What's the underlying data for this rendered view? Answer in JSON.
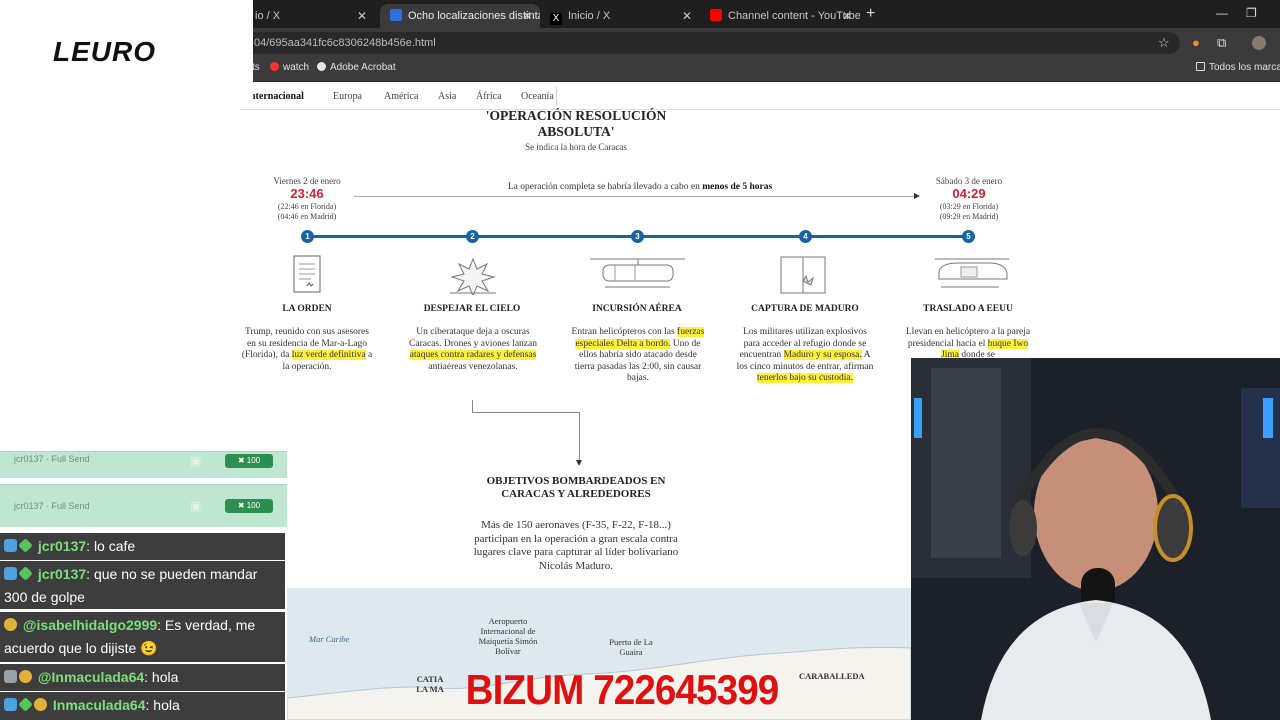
{
  "browser": {
    "tabs": [
      {
        "label": "io / X",
        "active": false
      },
      {
        "label": "Ocho localizaciones distintas p",
        "active": true
      },
      {
        "label": "Inicio / X",
        "active": false
      },
      {
        "label": "Channel content - YouTube Stu",
        "active": false
      }
    ],
    "url": "04/695aa341fc6c8306248b456e.html",
    "bookmarks": [
      {
        "label": "ts"
      },
      {
        "label": "watch"
      },
      {
        "label": "Adobe Acrobat"
      },
      {
        "label": "Todos los marcadores"
      }
    ]
  },
  "page": {
    "nav": [
      "nternacional",
      "Europa",
      "América",
      "Asia",
      "África",
      "Oceanía"
    ],
    "title": "'OPERACIÓN RESOLUCIÓN ABSOLUTA'",
    "subtitle": "Se indica la hora de Caracas",
    "start": {
      "day": "Viernes 2 de enero",
      "time": "23:46",
      "florida": "(22:46 en Florida)",
      "madrid": "(04:46 en Madrid)"
    },
    "end": {
      "day": "Sábado 3 de enero",
      "time": "04:29",
      "florida": "(03:29 en Florida)",
      "madrid": "(09:29 en Madrid)"
    },
    "duration": {
      "text": "La operación completa se habría llevado a cabo en ",
      "bold": "menos de 5 horas"
    },
    "stages": [
      {
        "num": "1",
        "title": "LA ORDEN",
        "parts": [
          [
            "Trump, reunido con sus asesores en su residencia de Mar-a-Lago (Florida), da ",
            false
          ],
          [
            "luz verde definitiva",
            true
          ],
          [
            " a la operación.",
            false
          ]
        ]
      },
      {
        "num": "2",
        "title": "DESPEJAR EL CIELO",
        "parts": [
          [
            "Un ciberataque deja a oscuras Caracas. Drones y aviones lanzan ",
            false
          ],
          [
            "ataques contra radares y defensas",
            true
          ],
          [
            " antiaéreas venezolanas.",
            false
          ]
        ]
      },
      {
        "num": "3",
        "title": "INCURSIÓN AÉREA",
        "parts": [
          [
            "Entran helicópteros con las ",
            false
          ],
          [
            "fuerzas especiales Delta a bordo.",
            true
          ],
          [
            " Uno de ellos habría sido atacado desde tierra pasadas las 2:00, sin causar bajas.",
            false
          ]
        ]
      },
      {
        "num": "4",
        "title": "CAPTURA DE MADURO",
        "parts": [
          [
            "Los militares utilizan explosivos para acceder al refugio donde se encuentran ",
            false
          ],
          [
            "Maduro y su esposa.",
            true
          ],
          [
            " A los cinco minutos de entrar, afirman ",
            false
          ],
          [
            "tenerlos bajo su custodia.",
            true
          ]
        ]
      },
      {
        "num": "5",
        "title": "TRASLADO A EEUU",
        "parts": [
          [
            "Llevan en helicóptero a la pareja presidencial hacia el ",
            false
          ],
          [
            "buque Iwo Jima",
            true
          ],
          [
            " donde se",
            false
          ]
        ]
      }
    ],
    "targets_title": "OBJETIVOS BOMBARDEADOS EN CARACAS Y ALREDEDORES",
    "targets_text": "Más de 150 aeronaves (F-35, F-22, F-18...) participan en la operación a gran escala contra lugares clave para capturar al líder bolivariano Nicolás Maduro.",
    "map_labels": {
      "sea": "Mar Caribe",
      "airport": "Aeropuerto Internacional de Maiquetía Simón Bolívar",
      "port": "Puerto de La Guaira",
      "left": "CATIA LA MA",
      "right": "CARABALLEDA"
    }
  },
  "overlay": {
    "logo": "LEURO",
    "alerts": [
      {
        "user": "jcr0137 · Full Send",
        "bits": "100"
      },
      {
        "user": "jcr0137 · Full Send",
        "bits": "100"
      }
    ],
    "chat": [
      {
        "name": "jcr0137",
        "msg": ": lo cafe"
      },
      {
        "name": "jcr0137",
        "msg": ": que no se pueden mandar 300 de golpe"
      },
      {
        "name": "@isabelhidalgo2999",
        "msg": ": Es verdad, me acuerdo que lo dijiste 😉"
      },
      {
        "name": "@Inmaculada64",
        "msg": ": hola"
      },
      {
        "name": "Inmaculada64",
        "msg": ": hola"
      }
    ],
    "bizum": "BIZUM 722645399"
  },
  "colors": {
    "timeline_blue": "#1664a3",
    "time_red": "#d6212f",
    "highlight": "#fff13a",
    "bizum_red": "#e01010",
    "chat_name_green": "#7be07b"
  }
}
